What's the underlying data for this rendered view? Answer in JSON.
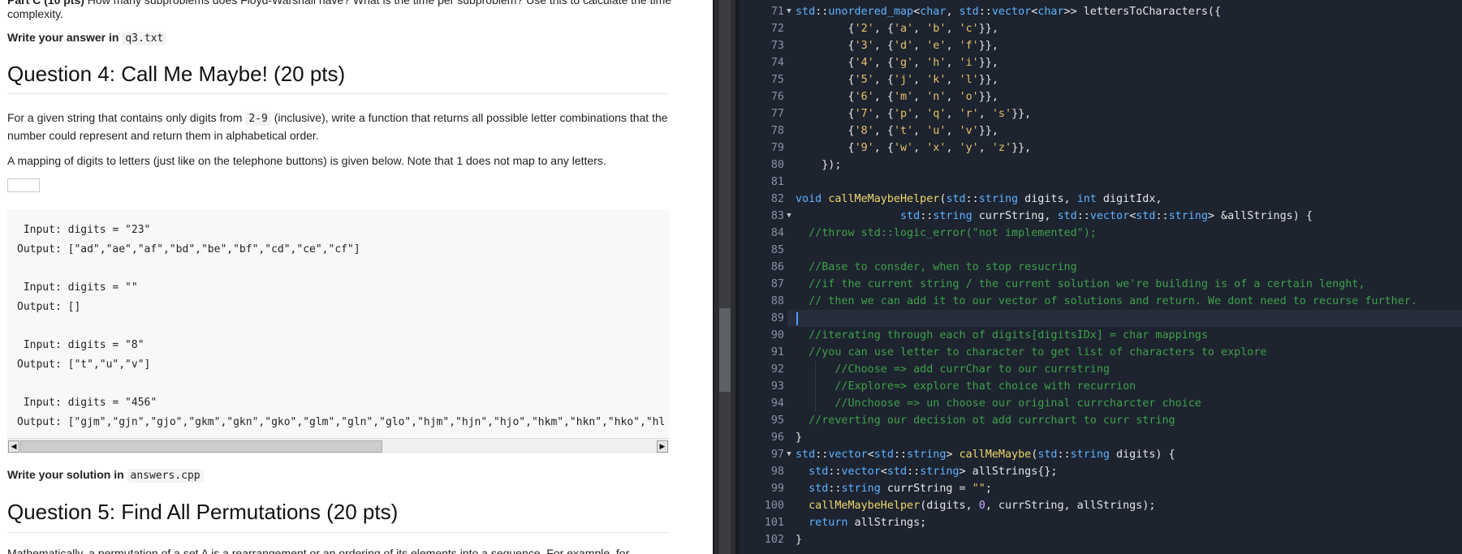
{
  "doc": {
    "cut_line_bold": "Part C (10 pts)",
    "cut_line_rest": " How many subproblems does Floyd-Warshall have? What is the time per subproblem? Use this to calculate the time complexity.",
    "write_q3_prefix": "Write your answer in",
    "write_q3_file": "q3.txt",
    "q4_heading": "Question 4: Call Me Maybe! (20 pts)",
    "q4_para1_a": "For a given string that contains only digits from",
    "q4_para1_code": "2-9",
    "q4_para1_b": "(inclusive), write a function that returns all possible letter combinations that the number could represent and return them in alphabetical order.",
    "q4_para2": "A mapping of digits to letters (just like on the telephone buttons) is given below. Note that 1 does not map to any letters.",
    "examples": [
      " Input: digits = \"23\"",
      "Output: [\"ad\",\"ae\",\"af\",\"bd\",\"be\",\"bf\",\"cd\",\"ce\",\"cf\"]",
      "",
      " Input: digits = \"\"",
      "Output: []",
      "",
      " Input: digits = \"8\"",
      "Output: [\"t\",\"u\",\"v\"]",
      "",
      " Input: digits = \"456\"",
      "Output: [\"gjm\",\"gjn\",\"gjo\",\"gkm\",\"gkn\",\"gko\",\"glm\",\"gln\",\"glo\",\"hjm\",\"hjn\",\"hjo\",\"hkm\",\"hkn\",\"hko\",\"hl"
    ],
    "write_sol_prefix": "Write your solution in",
    "write_sol_file": "answers.cpp",
    "q5_heading": "Question 5: Find All Permutations (20 pts)",
    "q5_cut": "Mathematically, a permutation of a set A is a rearrangement or an ordering of its elements into a sequence. For example, for",
    "scroll_left": "◀",
    "scroll_right": "▶"
  },
  "editor": {
    "lines": [
      {
        "n": "71",
        "fold": "▼"
      },
      {
        "n": "72"
      },
      {
        "n": "73"
      },
      {
        "n": "74"
      },
      {
        "n": "75"
      },
      {
        "n": "76"
      },
      {
        "n": "77"
      },
      {
        "n": "78"
      },
      {
        "n": "79"
      },
      {
        "n": "80"
      },
      {
        "n": "81"
      },
      {
        "n": "82"
      },
      {
        "n": "83",
        "fold": "▼"
      },
      {
        "n": "84"
      },
      {
        "n": "85"
      },
      {
        "n": "86"
      },
      {
        "n": "87"
      },
      {
        "n": "88"
      },
      {
        "n": "89"
      },
      {
        "n": "90"
      },
      {
        "n": "91"
      },
      {
        "n": "92"
      },
      {
        "n": "93"
      },
      {
        "n": "94"
      },
      {
        "n": "95"
      },
      {
        "n": "96"
      },
      {
        "n": "97",
        "fold": "▼"
      },
      {
        "n": "98"
      },
      {
        "n": "99"
      },
      {
        "n": "100"
      },
      {
        "n": "101"
      },
      {
        "n": "102"
      }
    ],
    "code": [
      [
        [
          "ns",
          "std"
        ],
        [
          "p",
          "::"
        ],
        [
          "t",
          "unordered_map"
        ],
        [
          "p",
          "<"
        ],
        [
          "t",
          "char"
        ],
        [
          "p",
          ", "
        ],
        [
          "ns",
          "std"
        ],
        [
          "p",
          "::"
        ],
        [
          "t",
          "vector"
        ],
        [
          "p",
          "<"
        ],
        [
          "t",
          "char"
        ],
        [
          "p",
          ">> lettersToCharacters({"
        ]
      ],
      [
        [
          "p",
          "        {"
        ],
        [
          "s",
          "'2'"
        ],
        [
          "p",
          ", {"
        ],
        [
          "s",
          "'a'"
        ],
        [
          "p",
          ", "
        ],
        [
          "s",
          "'b'"
        ],
        [
          "p",
          ", "
        ],
        [
          "s",
          "'c'"
        ],
        [
          "p",
          "}},"
        ]
      ],
      [
        [
          "p",
          "        {"
        ],
        [
          "s",
          "'3'"
        ],
        [
          "p",
          ", {"
        ],
        [
          "s",
          "'d'"
        ],
        [
          "p",
          ", "
        ],
        [
          "s",
          "'e'"
        ],
        [
          "p",
          ", "
        ],
        [
          "s",
          "'f'"
        ],
        [
          "p",
          "}},"
        ]
      ],
      [
        [
          "p",
          "        {"
        ],
        [
          "s",
          "'4'"
        ],
        [
          "p",
          ", {"
        ],
        [
          "s",
          "'g'"
        ],
        [
          "p",
          ", "
        ],
        [
          "s",
          "'h'"
        ],
        [
          "p",
          ", "
        ],
        [
          "s",
          "'i'"
        ],
        [
          "p",
          "}},"
        ]
      ],
      [
        [
          "p",
          "        {"
        ],
        [
          "s",
          "'5'"
        ],
        [
          "p",
          ", {"
        ],
        [
          "s",
          "'j'"
        ],
        [
          "p",
          ", "
        ],
        [
          "s",
          "'k'"
        ],
        [
          "p",
          ", "
        ],
        [
          "s",
          "'l'"
        ],
        [
          "p",
          "}},"
        ]
      ],
      [
        [
          "p",
          "        {"
        ],
        [
          "s",
          "'6'"
        ],
        [
          "p",
          ", {"
        ],
        [
          "s",
          "'m'"
        ],
        [
          "p",
          ", "
        ],
        [
          "s",
          "'n'"
        ],
        [
          "p",
          ", "
        ],
        [
          "s",
          "'o'"
        ],
        [
          "p",
          "}},"
        ]
      ],
      [
        [
          "p",
          "        {"
        ],
        [
          "s",
          "'7'"
        ],
        [
          "p",
          ", {"
        ],
        [
          "s",
          "'p'"
        ],
        [
          "p",
          ", "
        ],
        [
          "s",
          "'q'"
        ],
        [
          "p",
          ", "
        ],
        [
          "s",
          "'r'"
        ],
        [
          "p",
          ", "
        ],
        [
          "s",
          "'s'"
        ],
        [
          "p",
          "}},"
        ]
      ],
      [
        [
          "p",
          "        {"
        ],
        [
          "s",
          "'8'"
        ],
        [
          "p",
          ", {"
        ],
        [
          "s",
          "'t'"
        ],
        [
          "p",
          ", "
        ],
        [
          "s",
          "'u'"
        ],
        [
          "p",
          ", "
        ],
        [
          "s",
          "'v'"
        ],
        [
          "p",
          "}},"
        ]
      ],
      [
        [
          "p",
          "        {"
        ],
        [
          "s",
          "'9'"
        ],
        [
          "p",
          ", {"
        ],
        [
          "s",
          "'w'"
        ],
        [
          "p",
          ", "
        ],
        [
          "s",
          "'x'"
        ],
        [
          "p",
          ", "
        ],
        [
          "s",
          "'y'"
        ],
        [
          "p",
          ", "
        ],
        [
          "s",
          "'z'"
        ],
        [
          "p",
          "}},"
        ]
      ],
      [
        [
          "p",
          "    });"
        ]
      ],
      [],
      [
        [
          "k",
          "void "
        ],
        [
          "f",
          "callMeMaybeHelper"
        ],
        [
          "p",
          "("
        ],
        [
          "ns",
          "std"
        ],
        [
          "p",
          "::"
        ],
        [
          "t",
          "string"
        ],
        [
          "p",
          " digits, "
        ],
        [
          "k",
          "int"
        ],
        [
          "p",
          " digitIdx,"
        ]
      ],
      [
        [
          "p",
          "                "
        ],
        [
          "ns",
          "std"
        ],
        [
          "p",
          "::"
        ],
        [
          "t",
          "string"
        ],
        [
          "p",
          " currString, "
        ],
        [
          "ns",
          "std"
        ],
        [
          "p",
          "::"
        ],
        [
          "t",
          "vector"
        ],
        [
          "p",
          "<"
        ],
        [
          "ns",
          "std"
        ],
        [
          "p",
          "::"
        ],
        [
          "t",
          "string"
        ],
        [
          "p",
          "> &allStrings) {"
        ]
      ],
      [
        [
          "c",
          "  //throw std::logic_error(\"not implemented\");"
        ]
      ],
      [],
      [
        [
          "c",
          "  //Base to consder, when to stop resucring"
        ]
      ],
      [
        [
          "c",
          "  //if the current string / the current solution we're building is of a certain lenght,"
        ]
      ],
      [
        [
          "c",
          "  // then we can add it to our vector of solutions and return. We dont need to recurse further."
        ]
      ],
      [],
      [
        [
          "c",
          "  //iterating through each of digits[digitsIDx] = char mappings"
        ]
      ],
      [
        [
          "c",
          "  //you can use letter to character to get list of characters to explore"
        ]
      ],
      [
        [
          "c",
          "      //Choose => add currChar to our currstring"
        ]
      ],
      [
        [
          "c",
          "      //Explore=> explore that choice with recurrion"
        ]
      ],
      [
        [
          "c",
          "      //Unchoose => un choose our original currcharcter choice"
        ]
      ],
      [
        [
          "c",
          "  //reverting our decision ot add currchart to curr string"
        ]
      ],
      [
        [
          "p",
          "}"
        ]
      ],
      [
        [
          "ns",
          "std"
        ],
        [
          "p",
          "::"
        ],
        [
          "t",
          "vector"
        ],
        [
          "p",
          "<"
        ],
        [
          "ns",
          "std"
        ],
        [
          "p",
          "::"
        ],
        [
          "t",
          "string"
        ],
        [
          "p",
          "> "
        ],
        [
          "f",
          "callMeMaybe"
        ],
        [
          "p",
          "("
        ],
        [
          "ns",
          "std"
        ],
        [
          "p",
          "::"
        ],
        [
          "t",
          "string"
        ],
        [
          "p",
          " digits) {"
        ]
      ],
      [
        [
          "p",
          "  "
        ],
        [
          "ns",
          "std"
        ],
        [
          "p",
          "::"
        ],
        [
          "t",
          "vector"
        ],
        [
          "p",
          "<"
        ],
        [
          "ns",
          "std"
        ],
        [
          "p",
          "::"
        ],
        [
          "t",
          "string"
        ],
        [
          "p",
          "> allStrings{};"
        ]
      ],
      [
        [
          "p",
          "  "
        ],
        [
          "ns",
          "std"
        ],
        [
          "p",
          "::"
        ],
        [
          "t",
          "string"
        ],
        [
          "p",
          " currString = "
        ],
        [
          "s",
          "\"\""
        ],
        [
          "p",
          ";"
        ]
      ],
      [
        [
          "p",
          "  "
        ],
        [
          "f",
          "callMeMaybeHelper"
        ],
        [
          "p",
          "(digits, "
        ],
        [
          "n",
          "0"
        ],
        [
          "p",
          ", currString, allStrings);"
        ]
      ],
      [
        [
          "k",
          "  return"
        ],
        [
          "p",
          " allStrings;"
        ]
      ],
      [
        [
          "p",
          "}"
        ]
      ]
    ]
  }
}
